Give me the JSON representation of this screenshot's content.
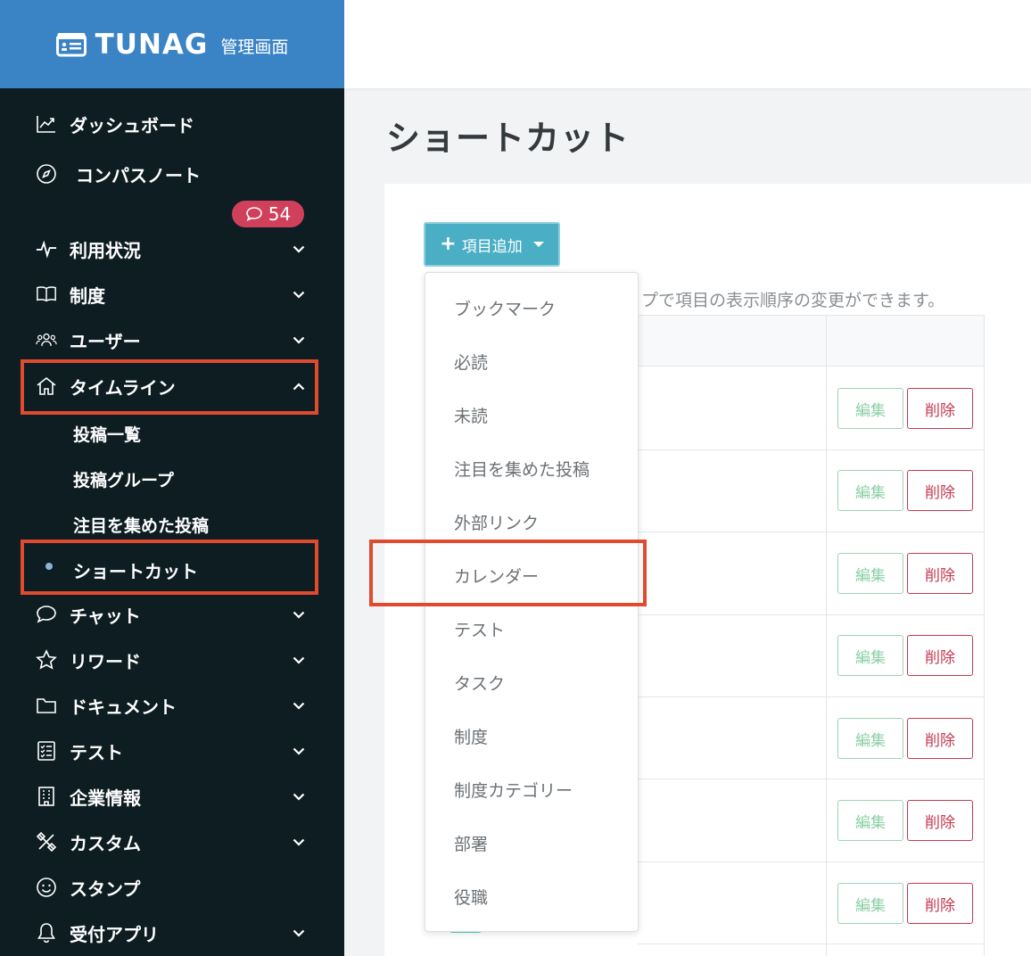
{
  "brand": {
    "name": "TUNAG",
    "sub": "管理画面"
  },
  "sidebar": {
    "items": [
      {
        "label": "ダッシュボード"
      },
      {
        "label": "コンパスノート"
      },
      {
        "label": "利用状況"
      },
      {
        "label": "制度"
      },
      {
        "label": "ユーザー"
      },
      {
        "label": "タイムライン"
      },
      {
        "label": "チャット"
      },
      {
        "label": "リワード"
      },
      {
        "label": "ドキュメント"
      },
      {
        "label": "テスト"
      },
      {
        "label": "企業情報"
      },
      {
        "label": "カスタム"
      },
      {
        "label": "スタンプ"
      },
      {
        "label": "受付アプリ"
      }
    ],
    "badge_count": "54",
    "timeline_sub": [
      {
        "label": "投稿一覧"
      },
      {
        "label": "投稿グループ"
      },
      {
        "label": "注目を集めた投稿"
      },
      {
        "label": "ショートカット"
      }
    ]
  },
  "main": {
    "title": "ショートカット",
    "add_button": "項目追加",
    "hint": "ップで項目の表示順序の変更ができます。",
    "edit_label": "編集",
    "delete_label": "削除"
  },
  "dropdown": {
    "items": [
      "ブックマーク",
      "必読",
      "未読",
      "注目を集めた投稿",
      "外部リンク",
      "カレンダー",
      "テスト",
      "タスク",
      "制度",
      "制度カテゴリー",
      "部署",
      "役職"
    ]
  },
  "colors": {
    "sidebar_bg": "#0d1d22",
    "brand_bg": "#3a83c5",
    "accent": "#4aaec4",
    "highlight": "#e04a2f",
    "danger": "#c63a52",
    "edit": "#8acfa4"
  }
}
